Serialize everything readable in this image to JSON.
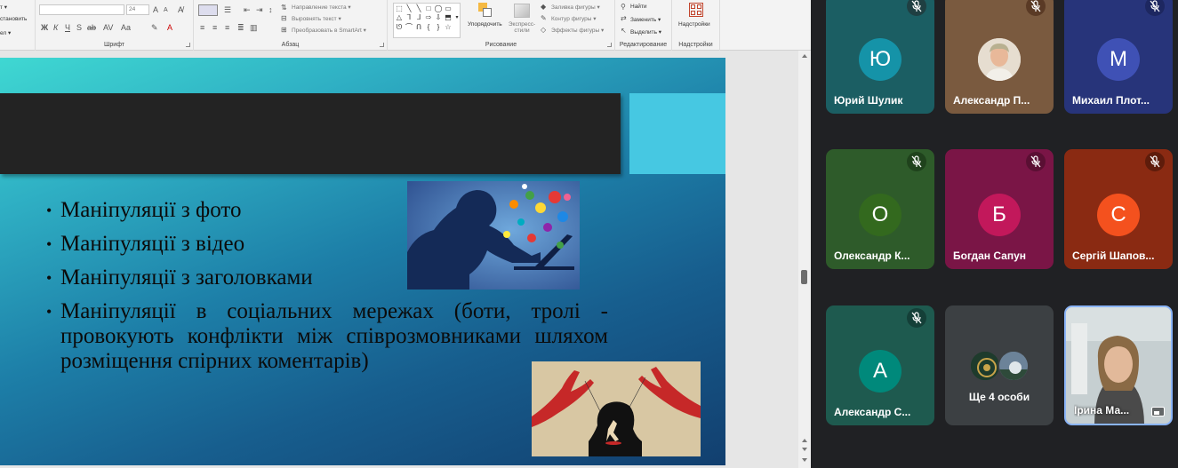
{
  "ribbon": {
    "top_left_1": "т ▾",
    "top_left_2": "становить",
    "top_left_3": "ел ▾",
    "font_size": "24",
    "font_group": "Шрифт",
    "paragraph_group": "Абзац",
    "text_direction": "Направление текста ▾",
    "align_text": "Выровнять текст ▾",
    "smartart": "Преобразовать в SmartArt ▾",
    "arrange": "Упорядочить",
    "quick_styles": "Экспресс-стили",
    "shape_fill": "Заливка фигуры ▾",
    "shape_outline": "Контур фигуры ▾",
    "shape_effects": "Эффекты фигуры ▾",
    "drawing_group": "Рисование",
    "find": "Найти",
    "replace": "Заменить ▾",
    "select": "Выделить ▾",
    "editing_group": "Редактирование",
    "addins": "Надстройки",
    "addins_group": "Надстройки"
  },
  "slide": {
    "bullets": [
      "Маніпуляції з фото",
      "Маніпуляції з відео",
      "Маніпуляції з заголовками",
      "Маніпуляції в соціальних мережах (боти, тролі - провокують конфлікти між співрозмовниками шляхом розміщення спірних коментарів)"
    ]
  },
  "participants": [
    {
      "name": "Юрий Шулик",
      "initial": "Ю",
      "bg": "#1b5e63",
      "avatar_bg": "#1593a8",
      "muted": true
    },
    {
      "name": "Александр П...",
      "initial": "",
      "bg": "#7a5a3f",
      "avatar_bg": "#e0d7cc",
      "muted": true,
      "photo": true
    },
    {
      "name": "Михаил Плот...",
      "initial": "М",
      "bg": "#27347a",
      "avatar_bg": "#3f51b5",
      "muted": true
    },
    {
      "name": "Олександр К...",
      "initial": "О",
      "bg": "#2e5b2a",
      "avatar_bg": "#33691e",
      "muted": true
    },
    {
      "name": "Богдан Сапун",
      "initial": "Б",
      "bg": "#7a1546",
      "avatar_bg": "#c2185b",
      "muted": true
    },
    {
      "name": "Сергій Шапов...",
      "initial": "С",
      "bg": "#8a2a12",
      "avatar_bg": "#f4511e",
      "muted": true
    },
    {
      "name": "Александр С...",
      "initial": "А",
      "bg": "#1e5a4f",
      "avatar_bg": "#00897b",
      "muted": true
    },
    {
      "name": "Ще 4 особи",
      "initial": "",
      "bg": "#3c4043",
      "avatar_bg": "#3c4043",
      "muted": false
    },
    {
      "name": "Ірина Ма...",
      "initial": "",
      "bg": "#9fb0b6",
      "avatar_bg": "#9fb0b6",
      "muted": false,
      "self": true
    }
  ],
  "colors": {
    "title_bar": "#232323",
    "title_accent": "#46c8e2",
    "meet_bg": "#202124",
    "mic_muted_bg": "#3c1f1f"
  }
}
